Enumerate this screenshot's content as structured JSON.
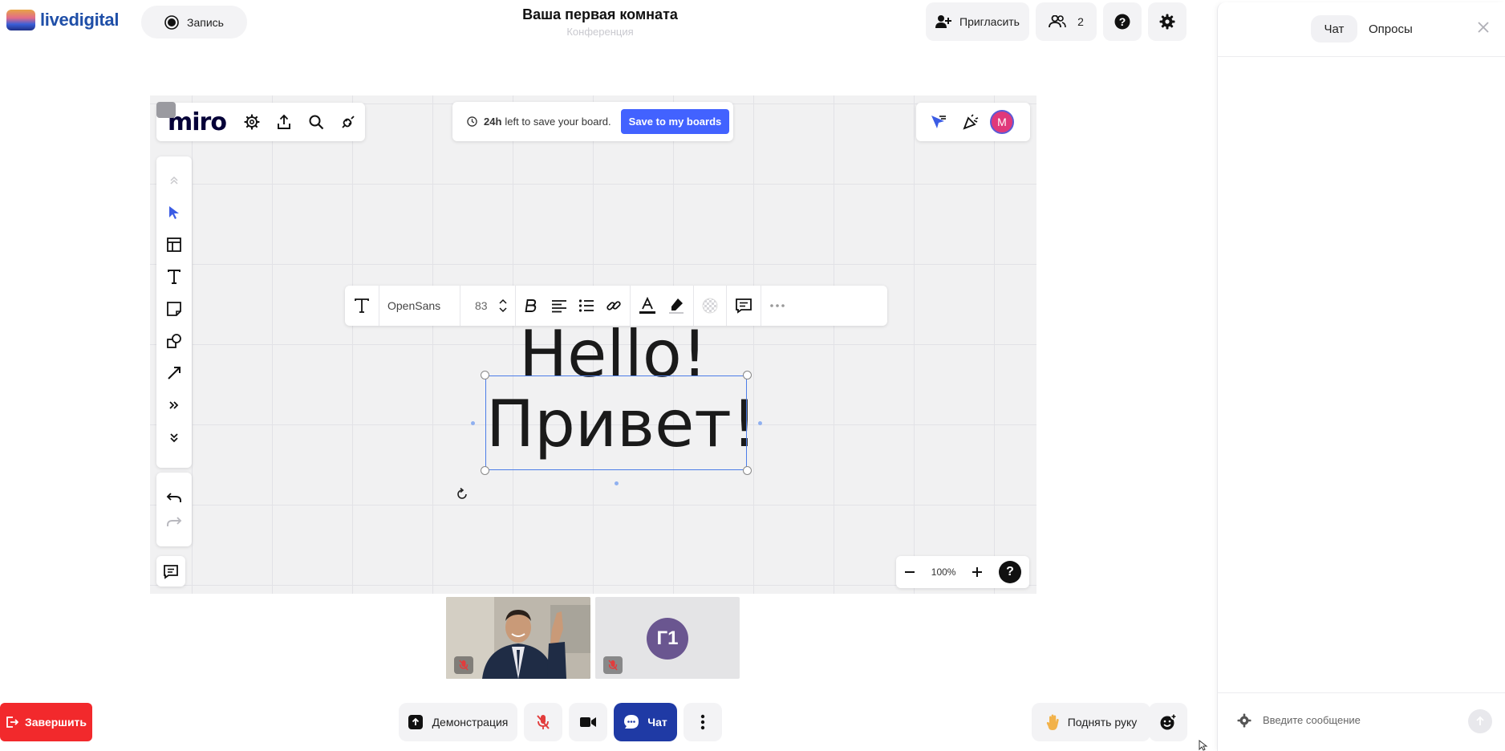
{
  "app": {
    "name": "livedigital"
  },
  "header": {
    "record_label": "Запись",
    "room_title": "Ваша первая комната",
    "room_subtitle": "Конференция",
    "invite_label": "Пригласить",
    "participants_count": "2"
  },
  "miro": {
    "logo_text": "miro",
    "save_banner": {
      "bold": "24h",
      "text": "left to save your board.",
      "button_label": "Save to my boards"
    },
    "user_avatar": "M",
    "format_bar": {
      "font_name": "OpenSans",
      "font_size": "83"
    },
    "canvas_text": {
      "line1": "Hello!",
      "line2": "Привет!"
    },
    "zoom_level": "100%",
    "help_label": "?"
  },
  "tiles": {
    "user_initials": "Г1"
  },
  "bottom_bar": {
    "end_label": "Завершить",
    "demo_label": "Демонстрация",
    "chat_label": "Чат",
    "raise_hand_label": "Поднять руку"
  },
  "chat_panel": {
    "tabs": [
      {
        "label": "Чат",
        "active": true
      },
      {
        "label": "Опросы",
        "active": false
      }
    ],
    "input_placeholder": "Введите сообщение"
  },
  "colors": {
    "accent_blue": "#1f3aa5",
    "miro_button": "#4262ff",
    "end_red": "#f2292c",
    "avatar_purple": "#6a5690"
  }
}
